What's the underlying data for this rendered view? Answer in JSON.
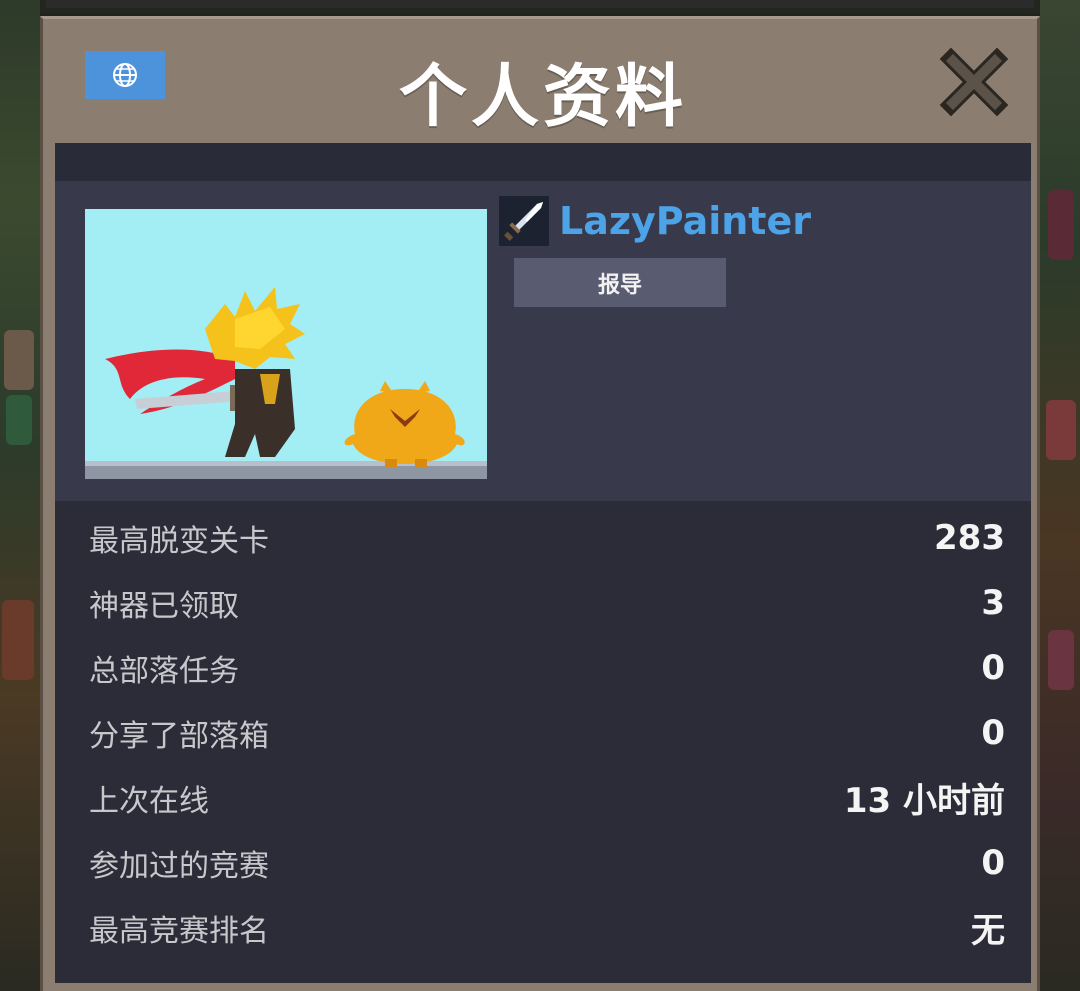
{
  "modal": {
    "title": "个人资料",
    "language_icon": "globe-icon",
    "close_icon": "close-x-icon"
  },
  "profile": {
    "username": "LazyPainter",
    "avatar_icon": "sword-icon",
    "report_label": "报导"
  },
  "stats": [
    {
      "label": "最高脱变关卡",
      "value": "283"
    },
    {
      "label": "神器已领取",
      "value": "3"
    },
    {
      "label": "总部落任务",
      "value": "0"
    },
    {
      "label": "分享了部落箱",
      "value": "0"
    },
    {
      "label": "上次在线",
      "value": "13 小时前"
    },
    {
      "label": "参加过的竞赛",
      "value": "0"
    },
    {
      "label": "最高竞赛排名",
      "value": "无"
    }
  ],
  "colors": {
    "panel_frame": "#8b7e70",
    "panel_body": "#2b2c38",
    "profile_band": "#383a4b",
    "username": "#4ca3e8",
    "language_button": "#4c93dc",
    "report_button": "#595b70"
  }
}
